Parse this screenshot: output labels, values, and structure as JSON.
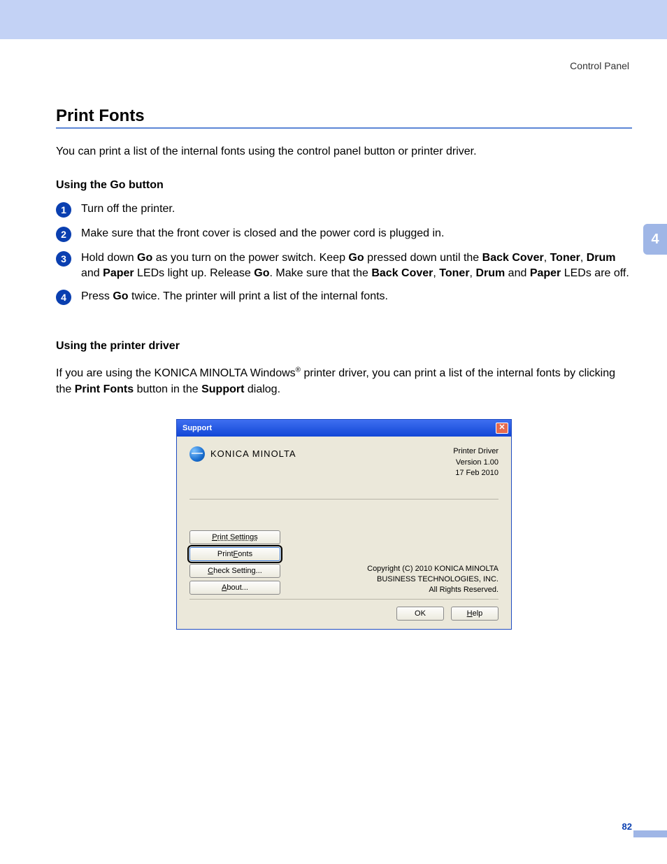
{
  "header": {
    "path": "Control Panel"
  },
  "chapter_tab": "4",
  "page_number": "82",
  "section": {
    "title": "Print Fonts",
    "intro": "You can print a list of the internal fonts using the control panel button or printer driver."
  },
  "go_section": {
    "heading": "Using the Go button",
    "steps": {
      "s1": {
        "num": "1",
        "text": "Turn off the printer."
      },
      "s2": {
        "num": "2",
        "text": "Make sure that the front cover is closed and the power cord is plugged in."
      },
      "s3": {
        "num": "3",
        "pre": "Hold down ",
        "b1": "Go",
        "mid1": " as you turn on the power switch. Keep ",
        "b2": "Go",
        "mid2": " pressed down until the ",
        "b3": "Back Cover",
        "c1": ", ",
        "b4": "Toner",
        "c2": ", ",
        "b5": "Drum",
        "c3": " and ",
        "b6": "Paper",
        "mid3": " LEDs light up. Release ",
        "b7": "Go",
        "mid4": ". Make sure that the ",
        "b8": "Back Cover",
        "c4": ", ",
        "b9": "Toner",
        "c5": ", ",
        "b10": "Drum",
        "c6": " and ",
        "b11": "Paper",
        "post": " LEDs are off."
      },
      "s4": {
        "num": "4",
        "pre": "Press ",
        "b1": "Go",
        "post": " twice. The printer will print a list of the internal fonts."
      }
    }
  },
  "driver_section": {
    "heading": "Using the printer driver",
    "para": {
      "pre": "If you are using the KONICA MINOLTA Windows",
      "sup": "®",
      "mid1": " printer driver, you can print a list of the internal fonts by clicking the ",
      "b1": "Print Fonts",
      "mid2": " button in the ",
      "b2": "Support",
      "post": " dialog."
    }
  },
  "dialog": {
    "title": "Support",
    "brand": "KONICA MINOLTA",
    "driver_label": "Printer Driver",
    "version": "Version 1.00",
    "date": "17 Feb 2010",
    "buttons": {
      "print_settings": {
        "u": "P",
        "rest": "rint Settings"
      },
      "print_fonts": {
        "pre": "Print ",
        "u": "F",
        "rest": "onts"
      },
      "check_setting": {
        "u": "C",
        "rest": "heck Setting..."
      },
      "about": {
        "u": "A",
        "rest": "bout..."
      },
      "ok": "OK",
      "help": {
        "u": "H",
        "rest": "elp"
      }
    },
    "copyright": {
      "l1": "Copyright (C) 2010 KONICA MINOLTA",
      "l2": "BUSINESS TECHNOLOGIES, INC.",
      "l3": "All Rights Reserved."
    }
  }
}
